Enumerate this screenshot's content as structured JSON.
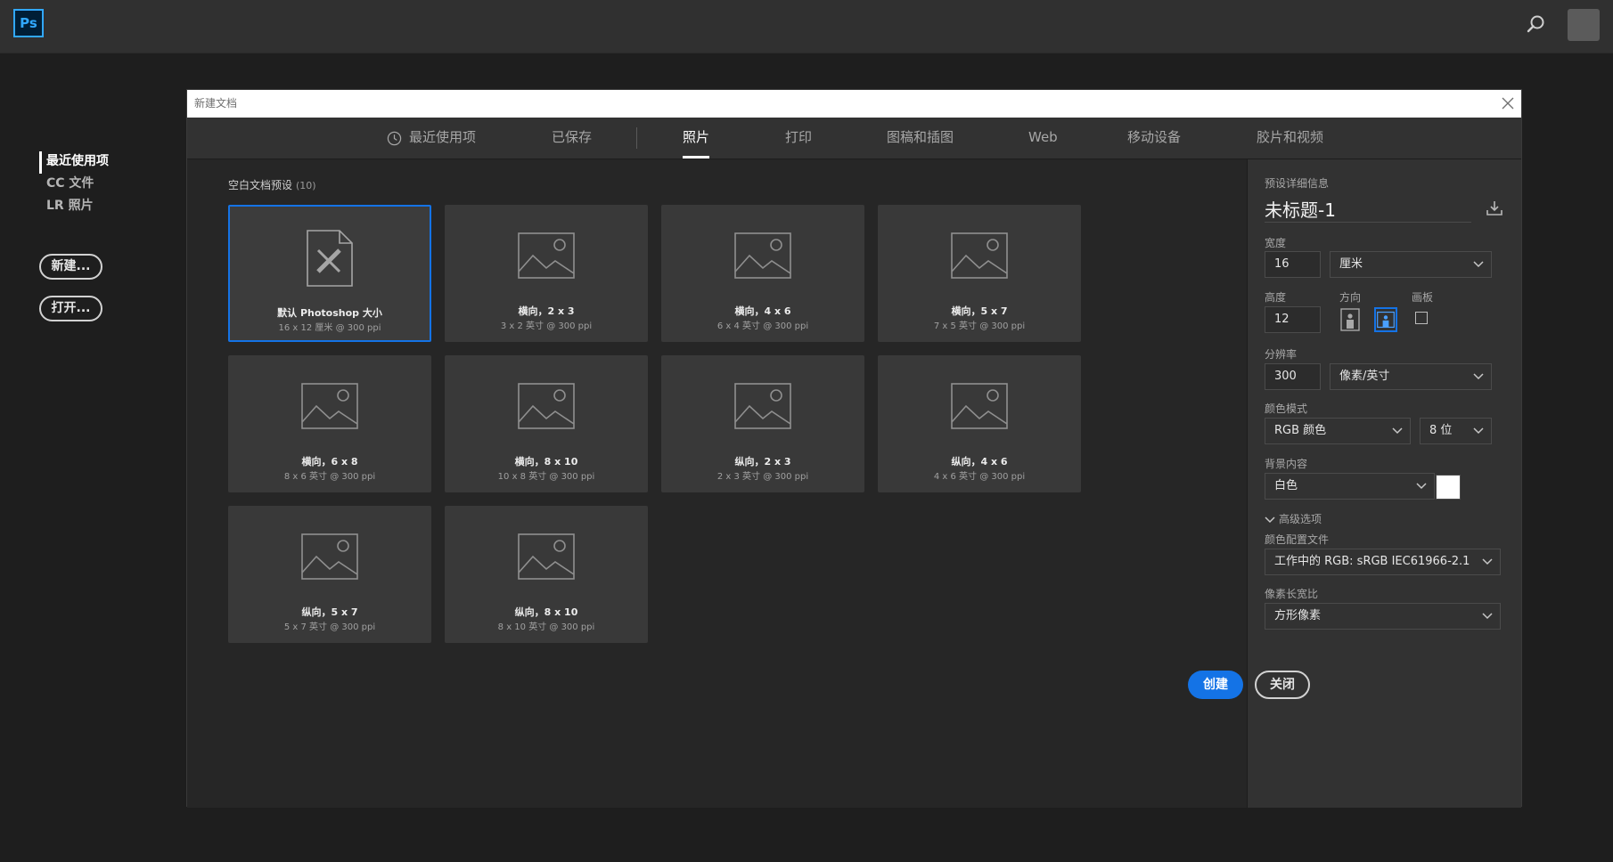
{
  "app": {
    "logo_text": "Ps"
  },
  "topbar": {
    "search_icon": "search-icon",
    "avatar": "user-avatar"
  },
  "home_nav": {
    "items": [
      {
        "label": "最近使用项",
        "active": true
      },
      {
        "label": "CC 文件",
        "active": false
      },
      {
        "label": "LR 照片",
        "active": false
      }
    ],
    "new_button": "新建...",
    "open_button": "打开..."
  },
  "dialog": {
    "title": "新建文档",
    "tabs": [
      {
        "label": "最近使用项",
        "active": false
      },
      {
        "label": "已保存",
        "active": false
      },
      {
        "label": "照片",
        "active": true
      },
      {
        "label": "打印",
        "active": false
      },
      {
        "label": "图稿和插图",
        "active": false
      },
      {
        "label": "Web",
        "active": false
      },
      {
        "label": "移动设备",
        "active": false
      },
      {
        "label": "胶片和视频",
        "active": false
      }
    ],
    "presets_title": "空白文档预设",
    "presets_count": "(10)",
    "presets": [
      {
        "title": "默认 Photoshop 大小",
        "subtitle": "16 x 12 厘米 @ 300 ppi",
        "icon": "document-icon",
        "selected": true
      },
      {
        "title": "横向，2 x 3",
        "subtitle": "3 x 2 英寸 @ 300 ppi",
        "icon": "image-icon",
        "selected": false
      },
      {
        "title": "横向，4 x 6",
        "subtitle": "6 x 4 英寸 @ 300 ppi",
        "icon": "image-icon",
        "selected": false
      },
      {
        "title": "横向，5 x 7",
        "subtitle": "7 x 5 英寸 @ 300 ppi",
        "icon": "image-icon",
        "selected": false
      },
      {
        "title": "横向，6 x 8",
        "subtitle": "8 x 6 英寸 @ 300 ppi",
        "icon": "image-icon",
        "selected": false
      },
      {
        "title": "横向，8 x 10",
        "subtitle": "10 x 8 英寸 @ 300 ppi",
        "icon": "image-icon",
        "selected": false
      },
      {
        "title": "纵向，2 x 3",
        "subtitle": "2 x 3 英寸 @ 300 ppi",
        "icon": "image-icon",
        "selected": false
      },
      {
        "title": "纵向，4 x 6",
        "subtitle": "4 x 6 英寸 @ 300 ppi",
        "icon": "image-icon",
        "selected": false
      },
      {
        "title": "纵向，5 x 7",
        "subtitle": "5 x 7 英寸 @ 300 ppi",
        "icon": "image-icon",
        "selected": false
      },
      {
        "title": "纵向，8 x 10",
        "subtitle": "8 x 10 英寸 @ 300 ppi",
        "icon": "image-icon",
        "selected": false
      }
    ],
    "details": {
      "heading": "预设详细信息",
      "name": "未标题-1",
      "width_label": "宽度",
      "width_value": "16",
      "width_unit": "厘米",
      "height_label": "高度",
      "height_value": "12",
      "orientation_label": "方向",
      "orientation": "landscape",
      "artboard_label": "画板",
      "artboard_checked": false,
      "resolution_label": "分辨率",
      "resolution_value": "300",
      "resolution_unit": "像素/英寸",
      "color_mode_label": "颜色模式",
      "color_mode": "RGB 颜色",
      "bit_depth": "8 位",
      "background_label": "背景内容",
      "background": "白色",
      "background_color": "#ffffff",
      "advanced_label": "高级选项",
      "color_profile_label": "颜色配置文件",
      "color_profile": "工作中的 RGB: sRGB IEC61966-2.1",
      "pixel_aspect_label": "像素长宽比",
      "pixel_aspect": "方形像素"
    },
    "create_button": "创建",
    "close_button": "关闭"
  },
  "colors": {
    "accent": "#1473e6",
    "ps_blue": "#31a8ff",
    "background": "#1e1e1e",
    "panel": "#323232"
  }
}
